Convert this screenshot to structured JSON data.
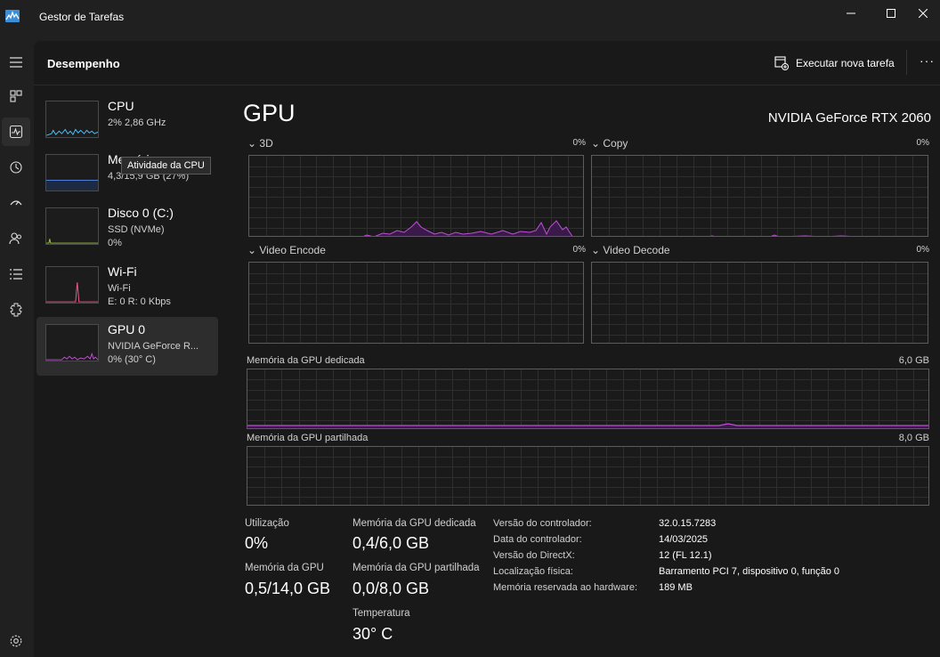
{
  "window": {
    "title": "Gestor de Tarefas"
  },
  "nav": {
    "items": [
      {
        "icon": "hamburger-icon"
      },
      {
        "icon": "processes-icon"
      },
      {
        "icon": "performance-icon",
        "active": true
      },
      {
        "icon": "history-icon"
      },
      {
        "icon": "startup-icon"
      },
      {
        "icon": "users-icon"
      },
      {
        "icon": "details-icon"
      },
      {
        "icon": "services-icon"
      },
      {
        "icon": "settings-icon"
      }
    ]
  },
  "header": {
    "title": "Desempenho",
    "run_task_label": "Executar nova tarefa",
    "more_label": "···"
  },
  "devices": [
    {
      "name": "CPU",
      "line1": "2%  2,86 GHz",
      "line2": "",
      "color": "#4cc2ff"
    },
    {
      "name": "Memória",
      "line1": "4,3/15,9 GB (27%)",
      "line2": "",
      "color": "#5c8df0"
    },
    {
      "name": "Disco 0 (C:)",
      "line1": "SSD (NVMe)",
      "line2": "0%",
      "color": "#9cc43a"
    },
    {
      "name": "Wi-Fi",
      "line1": "Wi-Fi",
      "line2": "E: 0  R: 0 Kbps",
      "color": "#f05a8c"
    },
    {
      "name": "GPU 0",
      "line1": "NVIDIA GeForce R...",
      "line2": "0%  (30° C)",
      "color": "#c04fd6",
      "selected": true
    }
  ],
  "tooltip": "Atividade da CPU",
  "gpu": {
    "title": "GPU",
    "model": "NVIDIA GeForce RTX 2060",
    "accent": "#c04fd6",
    "engines": [
      {
        "label": "3D",
        "pct": "0%"
      },
      {
        "label": "Copy",
        "pct": "0%"
      },
      {
        "label": "Video Encode",
        "pct": "0%"
      },
      {
        "label": "Video Decode",
        "pct": "0%"
      }
    ],
    "dedicated_graph": {
      "label": "Memória da GPU dedicada",
      "max": "6,0 GB"
    },
    "shared_graph": {
      "label": "Memória da GPU partilhada",
      "max": "8,0 GB"
    },
    "stats": {
      "utilization_label": "Utilização",
      "utilization": "0%",
      "gpu_memory_label": "Memória da GPU",
      "gpu_memory": "0,5/14,0 GB",
      "dedicated_label": "Memória da GPU dedicada",
      "dedicated": "0,4/6,0 GB",
      "shared_label": "Memória da GPU partilhada",
      "shared": "0,0/8,0 GB",
      "temp_label": "Temperatura",
      "temp": "30° C"
    },
    "info": [
      {
        "key": "Versão do controlador:",
        "value": "32.0.15.7283"
      },
      {
        "key": "Data do controlador:",
        "value": "14/03/2025"
      },
      {
        "key": "Versão do DirectX:",
        "value": "12 (FL 12.1)"
      },
      {
        "key": "Localização física:",
        "value": "Barramento PCI 7, dispositivo 0, função 0"
      },
      {
        "key": "Memória reservada ao hardware:",
        "value": "189 MB"
      }
    ]
  }
}
